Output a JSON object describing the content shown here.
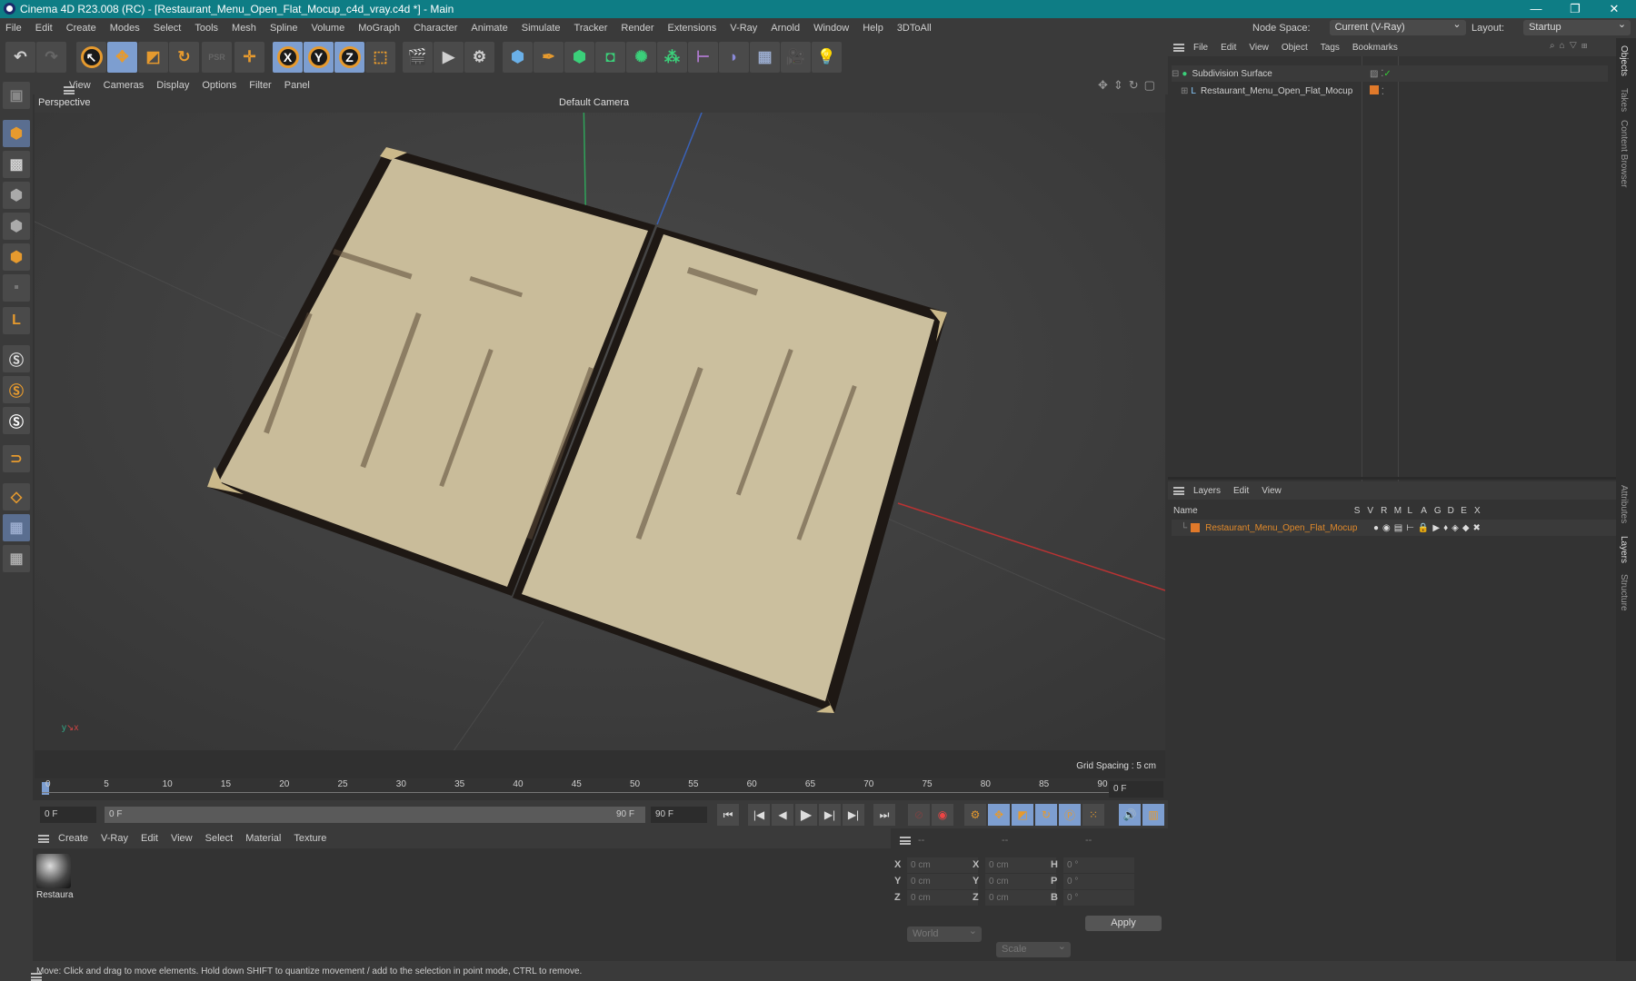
{
  "window": {
    "title": "Cinema 4D R23.008 (RC) - [Restaurant_Menu_Open_Flat_Mocup_c4d_vray.c4d *] - Main",
    "minimize": "—",
    "restore": "❐",
    "close": "✕"
  },
  "menu": [
    "File",
    "Edit",
    "Create",
    "Modes",
    "Select",
    "Tools",
    "Mesh",
    "Spline",
    "Volume",
    "MoGraph",
    "Character",
    "Animate",
    "Simulate",
    "Tracker",
    "Render",
    "Extensions",
    "V-Ray",
    "Arnold",
    "Window",
    "Help",
    "3DToAll"
  ],
  "node_space": {
    "label": "Node Space:",
    "value": "Current (V-Ray)"
  },
  "layout": {
    "label": "Layout:",
    "value": "Startup"
  },
  "toolbar": {
    "axis": [
      "X",
      "Y",
      "Z"
    ]
  },
  "viewport": {
    "menu": [
      "View",
      "Cameras",
      "Display",
      "Options",
      "Filter",
      "Panel"
    ],
    "view_name": "Perspective",
    "camera": "Default Camera",
    "grid_spacing": "Grid Spacing : 5 cm",
    "colors": {
      "page": "#c9bc9a",
      "cover": "#1e1814",
      "corner": "#cbb98a"
    }
  },
  "timeline": {
    "ticks": [
      "0",
      "5",
      "10",
      "15",
      "20",
      "25",
      "30",
      "35",
      "40",
      "45",
      "50",
      "55",
      "60",
      "65",
      "70",
      "75",
      "80",
      "85",
      "90"
    ],
    "current_frame": "0 F",
    "start": "0 F",
    "range_start": "0 F",
    "range_end": "90 F",
    "end": "90 F"
  },
  "materials": {
    "menu": [
      "Create",
      "V-Ray",
      "Edit",
      "View",
      "Select",
      "Material",
      "Texture"
    ],
    "items": [
      {
        "name": "Restaura"
      }
    ]
  },
  "coords": {
    "headers": [
      "--",
      "--",
      "--"
    ],
    "rows": [
      {
        "l1": "X",
        "v1": "0 cm",
        "l2": "X",
        "v2": "0 cm",
        "l3": "H",
        "v3": "0 °"
      },
      {
        "l1": "Y",
        "v1": "0 cm",
        "l2": "Y",
        "v2": "0 cm",
        "l3": "P",
        "v3": "0 °"
      },
      {
        "l1": "Z",
        "v1": "0 cm",
        "l2": "Z",
        "v2": "0 cm",
        "l3": "B",
        "v3": "0 °"
      }
    ],
    "space": "World",
    "mode": "Scale",
    "apply": "Apply"
  },
  "objects": {
    "menu": [
      "File",
      "Edit",
      "View",
      "Object",
      "Tags",
      "Bookmarks"
    ],
    "items": [
      {
        "name": "Subdivision Surface"
      },
      {
        "name": "Restaurant_Menu_Open_Flat_Mocup"
      }
    ]
  },
  "layers": {
    "menu": [
      "Layers",
      "Edit",
      "View"
    ],
    "columns": [
      "Name",
      "S",
      "V",
      "R",
      "M",
      "L",
      "A",
      "G",
      "D",
      "E",
      "X"
    ],
    "items": [
      {
        "name": "Restaurant_Menu_Open_Flat_Mocup",
        "color": "#e0792a"
      }
    ]
  },
  "side_tabs": [
    "Objects",
    "Takes",
    "Content Browser",
    "Attributes",
    "Layers",
    "Structure"
  ],
  "status": "Move: Click and drag to move elements. Hold down SHIFT to quantize movement / add to the selection in point mode, CTRL to remove."
}
